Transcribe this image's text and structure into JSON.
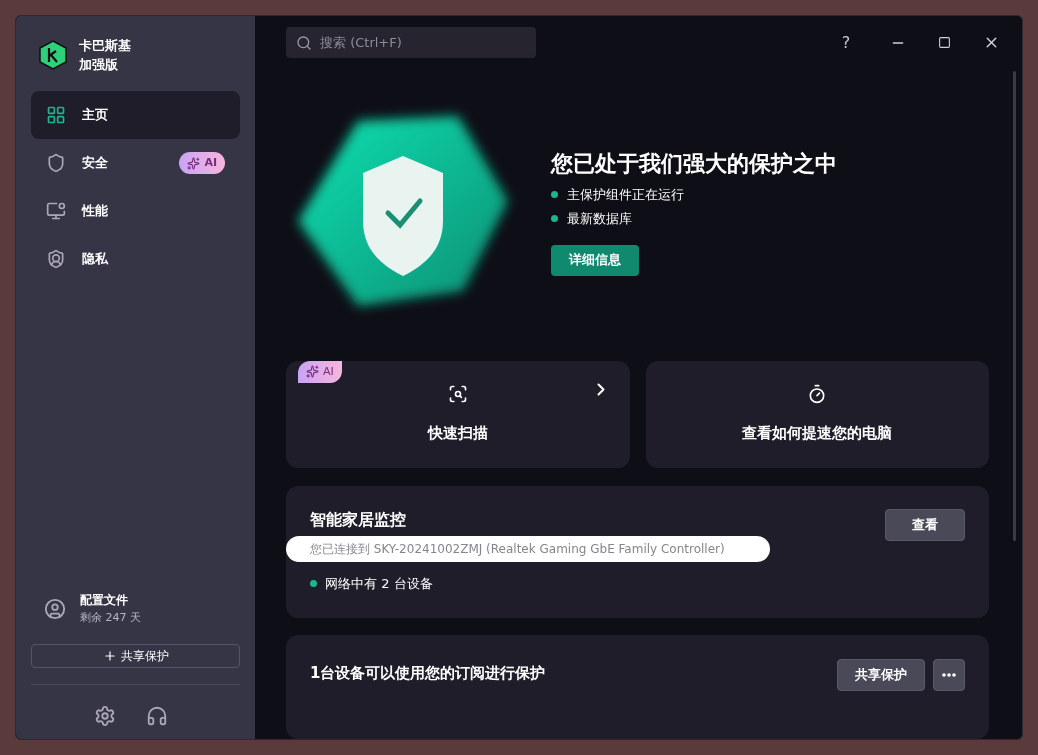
{
  "app": {
    "name": "卡巴斯基",
    "edition": "加强版"
  },
  "sidebar": {
    "items": [
      {
        "label": "主页",
        "selected": true,
        "kind": "home"
      },
      {
        "label": "安全",
        "selected": false,
        "kind": "shield",
        "badge": "AI"
      },
      {
        "label": "性能",
        "selected": false,
        "kind": "monitor"
      },
      {
        "label": "隐私",
        "selected": false,
        "kind": "privacy"
      }
    ],
    "profile": {
      "title": "配置文件",
      "subtitle": "剩余 247 天"
    },
    "share_button": "共享保护"
  },
  "search": {
    "placeholder": "搜索 (Ctrl+F)"
  },
  "title_bar": {
    "help": "?"
  },
  "hero": {
    "title": "您已处于我们强大的保护之中",
    "status": [
      "主保护组件正在运行",
      "最新数据库"
    ],
    "button": "详细信息"
  },
  "tiles": [
    {
      "label": "快速扫描",
      "kind": "scan",
      "badge": "AI",
      "has_arrow": true
    },
    {
      "label": "查看如何提速您的电脑",
      "kind": "timer",
      "has_arrow": false
    }
  ],
  "smart_home": {
    "title": "智能家居监控",
    "connection": "您已连接到 SKY-20241002ZMJ (Realtek Gaming GbE Family Controller)",
    "devices": "网络中有 2 台设备",
    "button": "查看"
  },
  "subscription": {
    "title": "1台设备可以使用您的订阅进行保护",
    "button": "共享保护"
  }
}
